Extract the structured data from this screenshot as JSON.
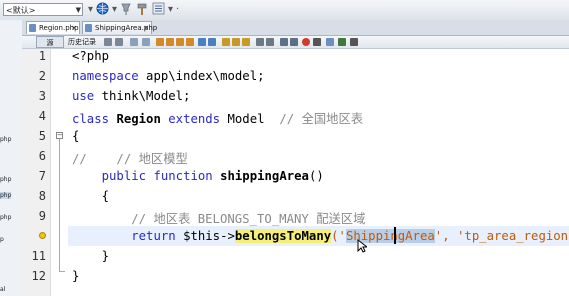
{
  "toolbar": {
    "combo_value": "<默认>",
    "icons": [
      "globe-icon",
      "pin-icon",
      "hammer-icon",
      "settings-icon"
    ]
  },
  "left_panel": {
    "labels": [
      "php",
      "php",
      "php",
      "php",
      "p",
      "al"
    ]
  },
  "tabs": [
    {
      "label": "Region.php",
      "close": "×",
      "active": true
    },
    {
      "label": "ShippingArea.php",
      "close": "×",
      "active": false
    }
  ],
  "editor_toolbar": {
    "source_label": "源",
    "history_label": "历史记录"
  },
  "code": {
    "line_numbers": [
      "1",
      "2",
      "3",
      "4",
      "5",
      "6",
      "7",
      "8",
      "9",
      "10",
      "11",
      "12"
    ],
    "l1": "<?php",
    "l2_kw": "namespace",
    "l2_rest": " app\\index\\model;",
    "l3_kw": "use",
    "l3_rest": " think\\Model;",
    "l4_kw1": "class",
    "l4_name": "Region",
    "l4_kw2": "extends",
    "l4_base": "Model",
    "l4_comment": "// 全国地区表",
    "l5": "{",
    "l6_comment": "//    // 地区模型",
    "l7_kw1": "public",
    "l7_kw2": "function",
    "l7_name": "shippingArea",
    "l7_rest": "()",
    "l8": "{",
    "l9_comment": "// 地区表 BELONGS_TO_MANY 配送区域",
    "l10_kw": "return",
    "l10_var": "$this->",
    "l10_method": "belongsToMany",
    "l10_open": "('",
    "l10_str1": "ShippingArea",
    "l10_mid": "', ",
    "l10_str2": "'tp_area_region'",
    "l10_end": ");",
    "l11": "}",
    "l12": "}"
  }
}
